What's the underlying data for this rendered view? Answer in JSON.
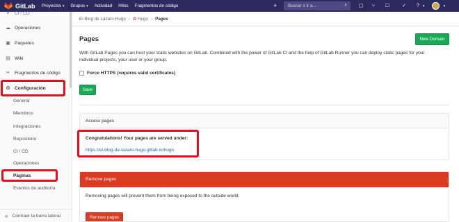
{
  "topbar": {
    "brand": "GitLab",
    "nav": [
      {
        "label": "Proyectos",
        "caret": true
      },
      {
        "label": "Grupos",
        "caret": true
      },
      {
        "label": "Actividad",
        "caret": false
      },
      {
        "label": "Hitos",
        "caret": false
      },
      {
        "label": "Fragmentos de código",
        "caret": false
      }
    ],
    "search_placeholder": "Buscar o ir a...",
    "brand_color": "#2b2a5f"
  },
  "sidebar": {
    "top_item": "CI / CD",
    "items": [
      {
        "label": "Operaciones",
        "icon": "cloud-icon"
      },
      {
        "label": "Paquetes",
        "icon": "package-icon"
      },
      {
        "label": "Wiki",
        "icon": "book-icon"
      },
      {
        "label": "Fragmentos de código",
        "icon": "scissors-icon"
      },
      {
        "label": "Configuración",
        "icon": "gear-icon"
      }
    ],
    "sub_items": [
      "General",
      "Miembros",
      "Integraciones",
      "Repositorio",
      "CI / CD",
      "Operaciones",
      "Páginas",
      "Eventos de auditoría"
    ],
    "collapse_label": "Contraer la barra lateral"
  },
  "breadcrumb": [
    "El Blog de Lázaro-Hugo",
    "Hugo",
    "Pages"
  ],
  "main": {
    "title": "Pages",
    "new_domain_label": "New Domain",
    "description": "With GitLab Pages you can host your static websites on GitLab. Combined with the power of GitLab CI and the help of GitLab Runner you can deploy static pages for your individual projects, your user or your group.",
    "force_https_label": "Force HTTPS (requires valid certificates)",
    "save_label": "Save"
  },
  "access_panel": {
    "title": "Access pages",
    "congrats": "Congratulations! Your pages are served under:",
    "url": "https://el-blog-de-lazaro-hugo.gitlab.io/hugo"
  },
  "remove_panel": {
    "title": "Remove pages",
    "text": "Removing pages will prevent them from being exposed to the outside world.",
    "button_label": "Remove pages"
  },
  "colors": {
    "green": "#1aaa55",
    "danger": "#db3b21",
    "link": "#1b69b6",
    "highlight": "#e0101c"
  }
}
